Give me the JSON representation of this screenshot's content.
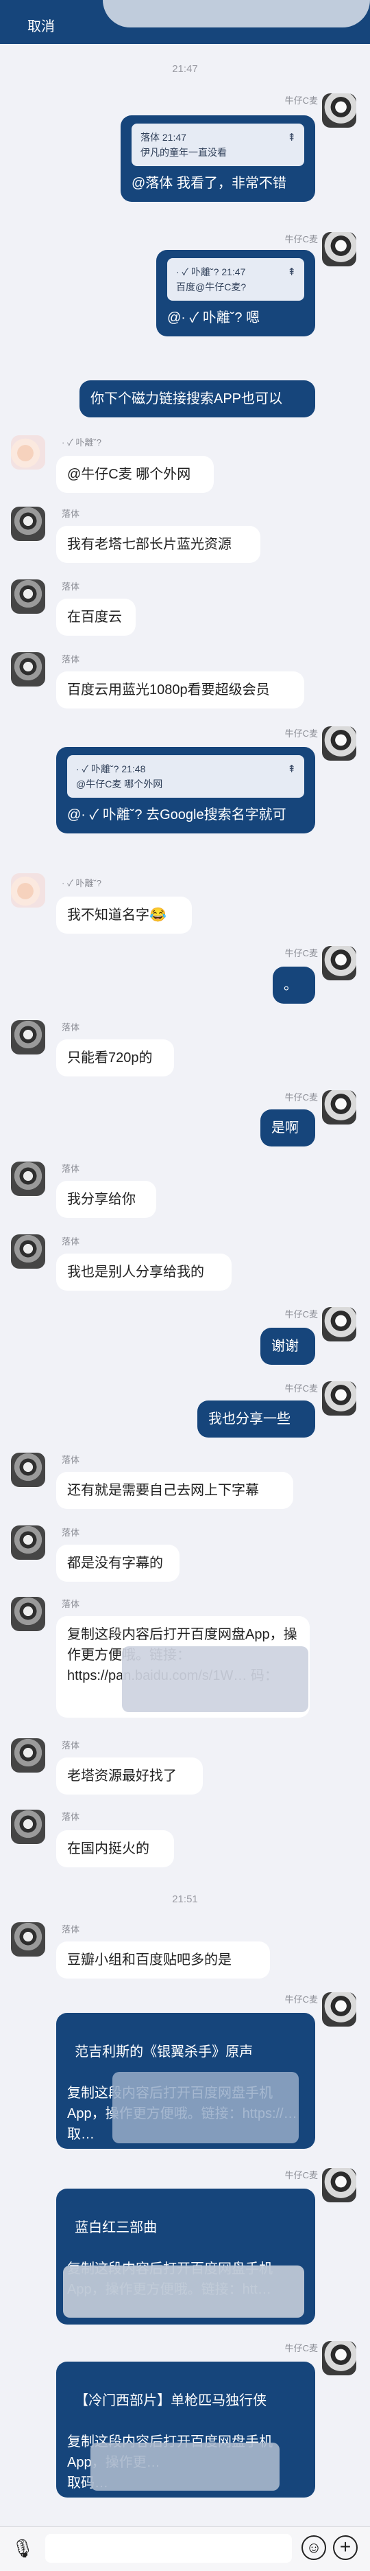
{
  "header": {
    "cancel": "取消"
  },
  "times": [
    "21:47",
    "21:51"
  ],
  "messages": [
    {
      "sender": "牛仔C麦",
      "quote": {
        "header": "落体 21:47",
        "body": "伊凡的童年一直没看"
      },
      "text": "@落体 我看了，非常不错"
    },
    {
      "sender": "牛仔C麦",
      "quote": {
        "header": "· ✓ 卟離˘? 21:47",
        "body": "百度@牛仔C麦?"
      },
      "text": "@· ✓ 卟離˘? 嗯"
    },
    {
      "text": "你下个磁力链接搜索APP也可以"
    },
    {
      "sender": "· ✓ 卟離˘?",
      "text": "@牛仔C麦 哪个外网"
    },
    {
      "sender": "落体",
      "text": "我有老塔七部长片蓝光资源"
    },
    {
      "sender": "落体",
      "text": "在百度云"
    },
    {
      "sender": "落体",
      "text": "百度云用蓝光1080p看要超级会员"
    },
    {
      "sender": "牛仔C麦",
      "quote": {
        "header": "· ✓ 卟離˘? 21:48",
        "body": "@牛仔C麦 哪个外网"
      },
      "text": "@· ✓ 卟離˘? 去Google搜索名字就可"
    },
    {
      "sender": "· ✓ 卟離˘?",
      "text": "我不知道名字😂"
    },
    {
      "sender": "牛仔C麦",
      "text": "。"
    },
    {
      "sender": "落体",
      "text": "只能看720p的"
    },
    {
      "sender": "牛仔C麦",
      "text": "是啊"
    },
    {
      "sender": "落体",
      "text": "我分享给你"
    },
    {
      "sender": "落体",
      "text": "我也是别人分享给我的"
    },
    {
      "sender": "牛仔C麦",
      "text": "谢谢"
    },
    {
      "sender": "牛仔C麦",
      "text": "我也分享一些"
    },
    {
      "sender": "落体",
      "text": "还有就是需要自己去网上下字幕"
    },
    {
      "sender": "落体",
      "text": "都是没有字幕的"
    },
    {
      "sender": "落体",
      "text": "复制这段内容后打开百度网盘App，操作更方便哦。链接：https://pan.baidu.com/s/1W… 码："
    },
    {
      "sender": "落体",
      "text": "老塔资源最好找了"
    },
    {
      "sender": "落体",
      "text": "在国内挺火的"
    },
    {
      "sender": "落体",
      "text": "豆瓣小组和百度贴吧多的是"
    },
    {
      "sender": "牛仔C麦",
      "text": "范吉利斯的《银翼杀手》原声\n\n复制这段内容后打开百度网盘手机App，操作更方便哦。链接：https://…\n取…"
    },
    {
      "sender": "牛仔C麦",
      "text": "蓝白红三部曲\n\n复制这段内容后打开百度网盘手机App，操作更方便哦。链接：htt…"
    },
    {
      "sender": "牛仔C麦",
      "text": "【冷门西部片】单枪匹马独行侠\n\n复制这段内容后打开百度网盘手机App，操作更…\n取码…"
    }
  ],
  "colors": {
    "header": "#16457b",
    "outgoing": "#16457b",
    "incoming": "#ffffff",
    "background": "#f1f2f7"
  },
  "icons": [
    "pin-icon",
    "mic-icon",
    "emoji-icon",
    "plus-icon"
  ]
}
